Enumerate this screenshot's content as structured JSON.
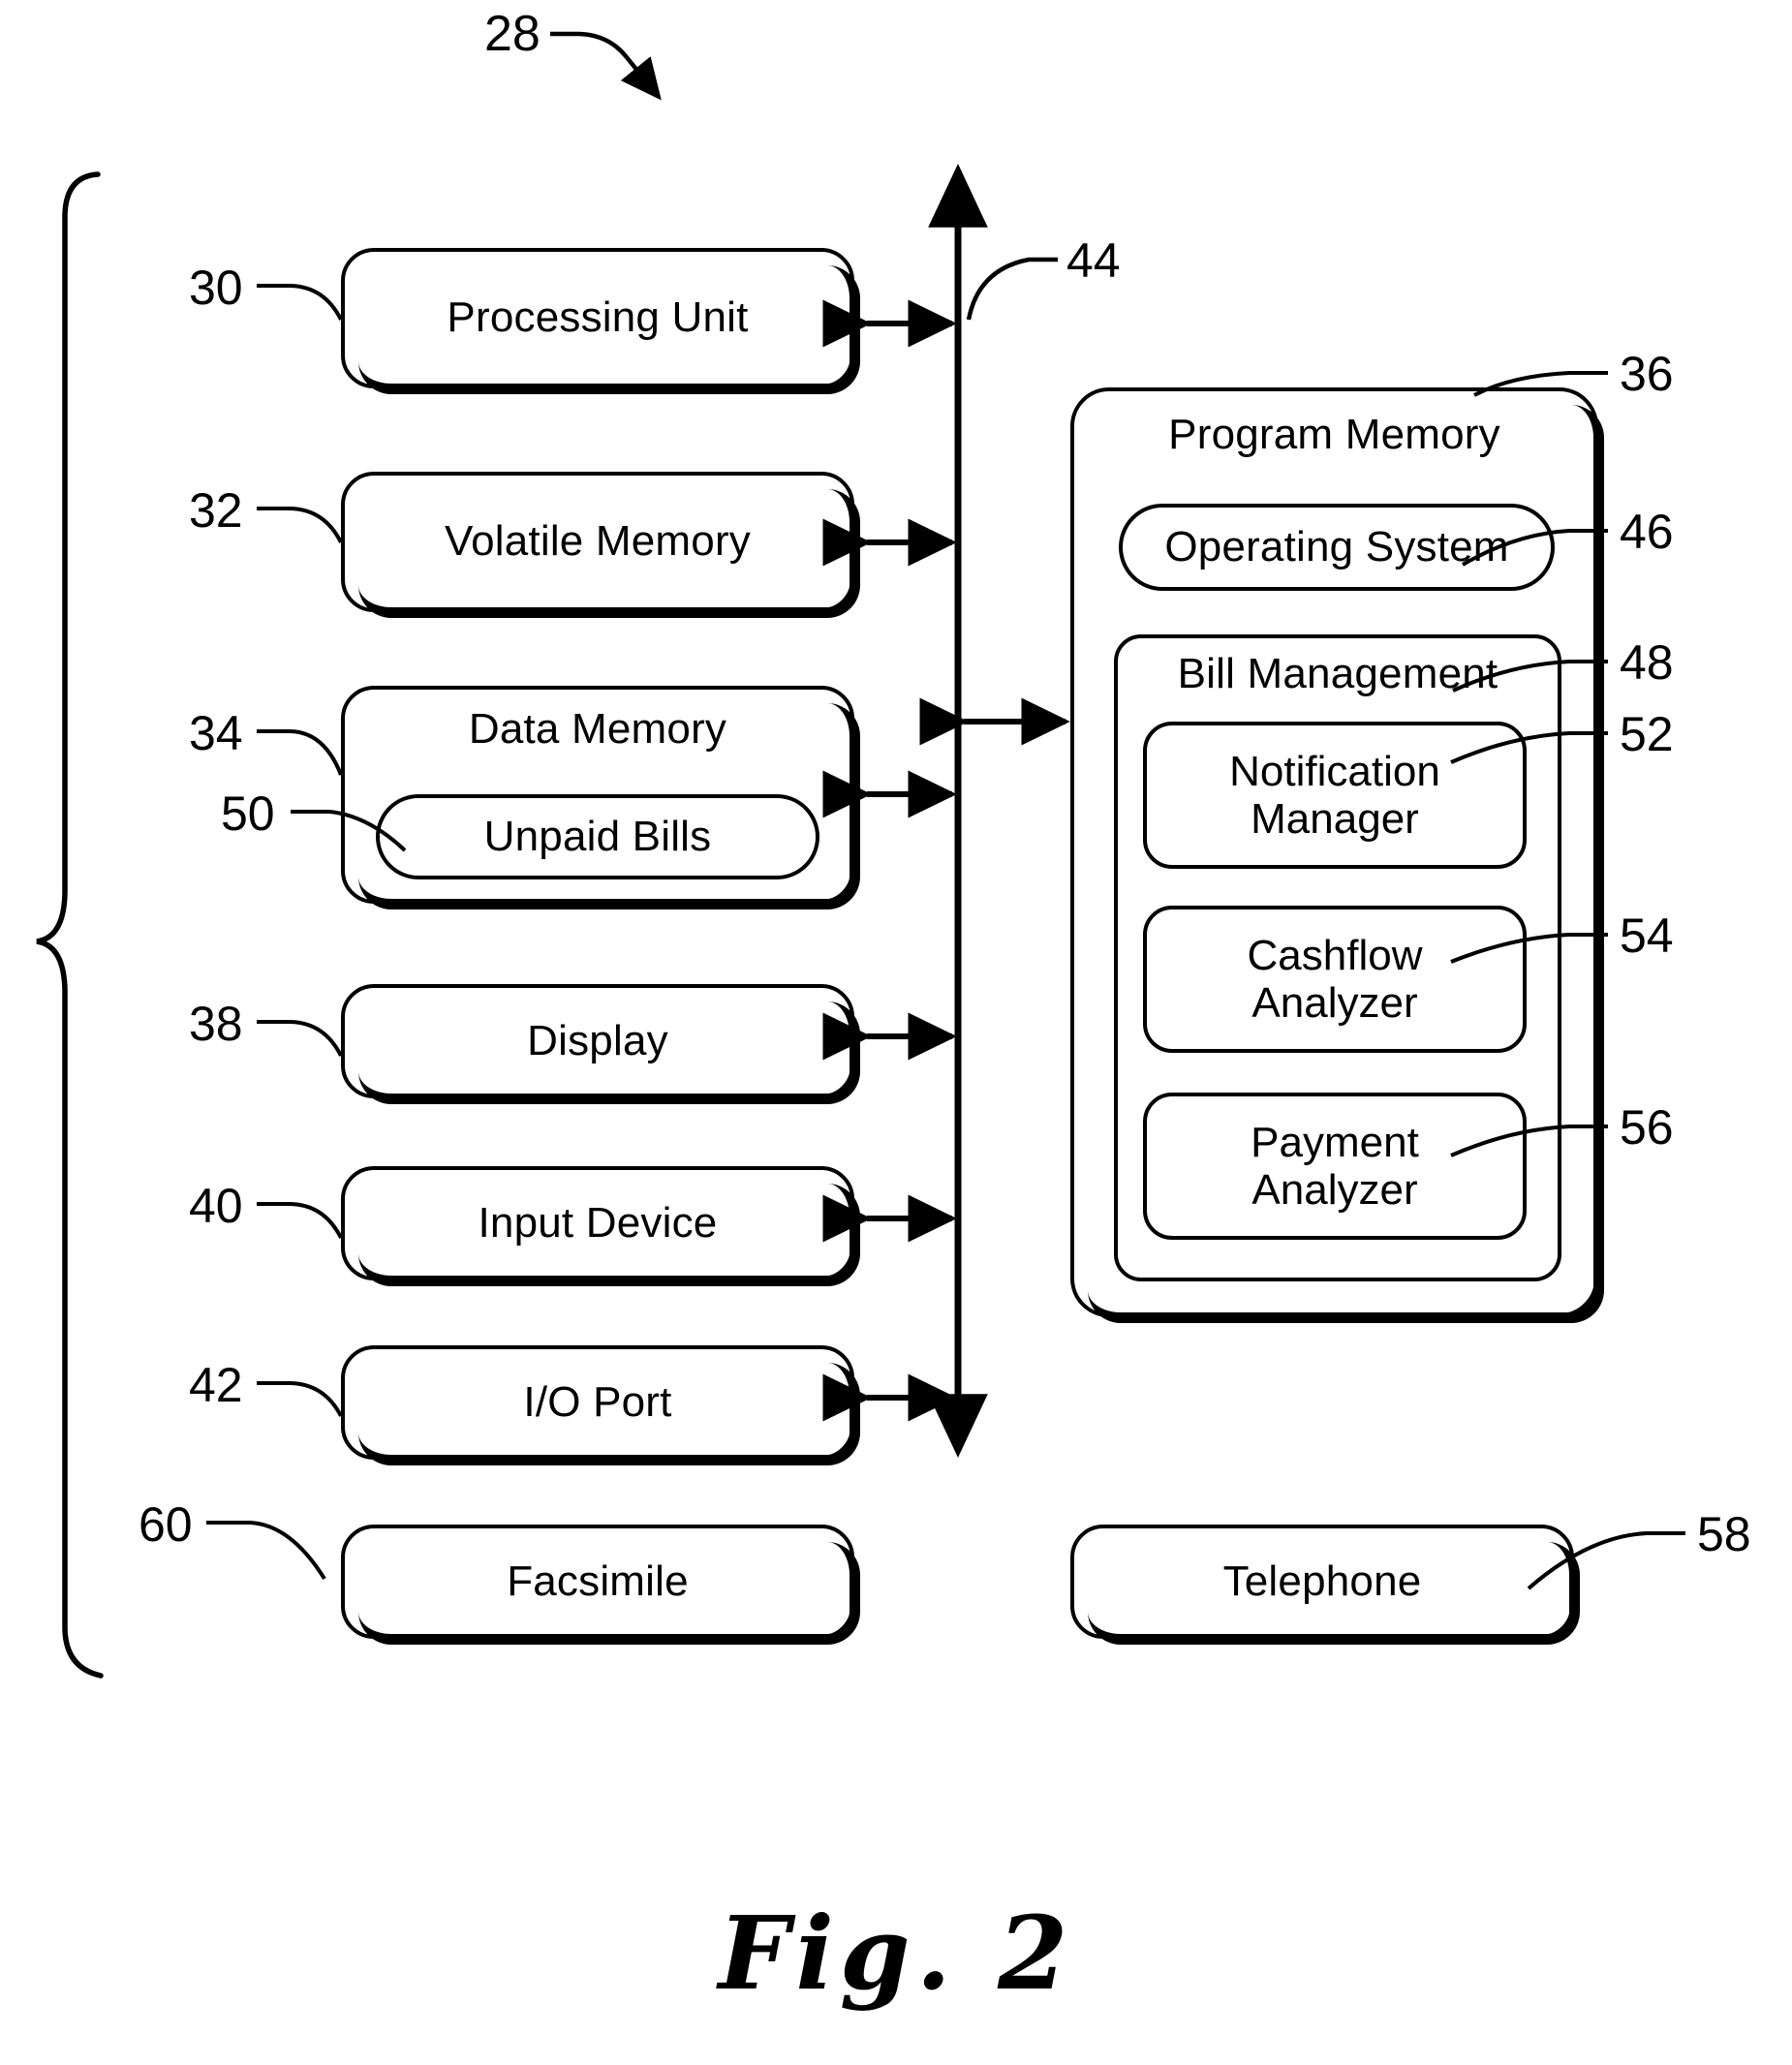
{
  "figure": {
    "caption": "Fig. 2",
    "system_ref": "28"
  },
  "left_column": {
    "items": [
      {
        "ref": "30",
        "label": "Processing Unit"
      },
      {
        "ref": "32",
        "label": "Volatile Memory"
      },
      {
        "ref": "34",
        "label": "Data Memory"
      },
      {
        "ref": "38",
        "label": "Display"
      },
      {
        "ref": "40",
        "label": "Input Device"
      },
      {
        "ref": "42",
        "label": "I/O Port"
      },
      {
        "ref": "60",
        "label": "Facsimile"
      }
    ],
    "nested": {
      "ref": "50",
      "label": "Unpaid Bills"
    }
  },
  "bus": {
    "ref": "44"
  },
  "right_column": {
    "program_memory": {
      "ref": "36",
      "label": "Program Memory",
      "operating_system": {
        "ref": "46",
        "label": "Operating System"
      },
      "bill_management": {
        "ref": "48",
        "label": "Bill Management",
        "modules": [
          {
            "ref": "52",
            "label_line1": "Notification",
            "label_line2": "Manager"
          },
          {
            "ref": "54",
            "label_line1": "Cashflow",
            "label_line2": "Analyzer"
          },
          {
            "ref": "56",
            "label_line1": "Payment",
            "label_line2": "Analyzer"
          }
        ]
      }
    },
    "telephone": {
      "ref": "58",
      "label": "Telephone"
    }
  },
  "colors": {
    "ink": "#000000",
    "paper": "#ffffff"
  }
}
